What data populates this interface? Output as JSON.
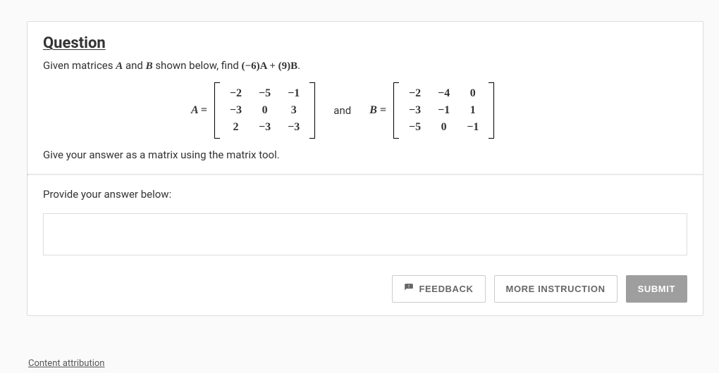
{
  "question": {
    "heading": "Question",
    "prompt_prefix": "Given matrices ",
    "varA": "A",
    "prompt_mid": " and ",
    "varB": "B",
    "prompt_suffix": " shown below, find ",
    "expression": "(−6)A + (9)B",
    "prompt_end": ".",
    "matrixA_label": "A =",
    "matrixA": [
      [
        "−2",
        "−5",
        "−1"
      ],
      [
        "−3",
        "0",
        "3"
      ],
      [
        "2",
        "−3",
        "−3"
      ]
    ],
    "and_word": "and",
    "matrixB_label": "B =",
    "matrixB": [
      [
        "−2",
        "−4",
        "0"
      ],
      [
        "−3",
        "−1",
        "1"
      ],
      [
        "−5",
        "0",
        "−1"
      ]
    ],
    "hint": "Give your answer as a matrix using the matrix tool."
  },
  "answer": {
    "label": "Provide your answer below:",
    "value": ""
  },
  "buttons": {
    "feedback": "FEEDBACK",
    "more": "MORE INSTRUCTION",
    "submit": "SUBMIT"
  },
  "footer": {
    "attribution": "Content attribution"
  }
}
